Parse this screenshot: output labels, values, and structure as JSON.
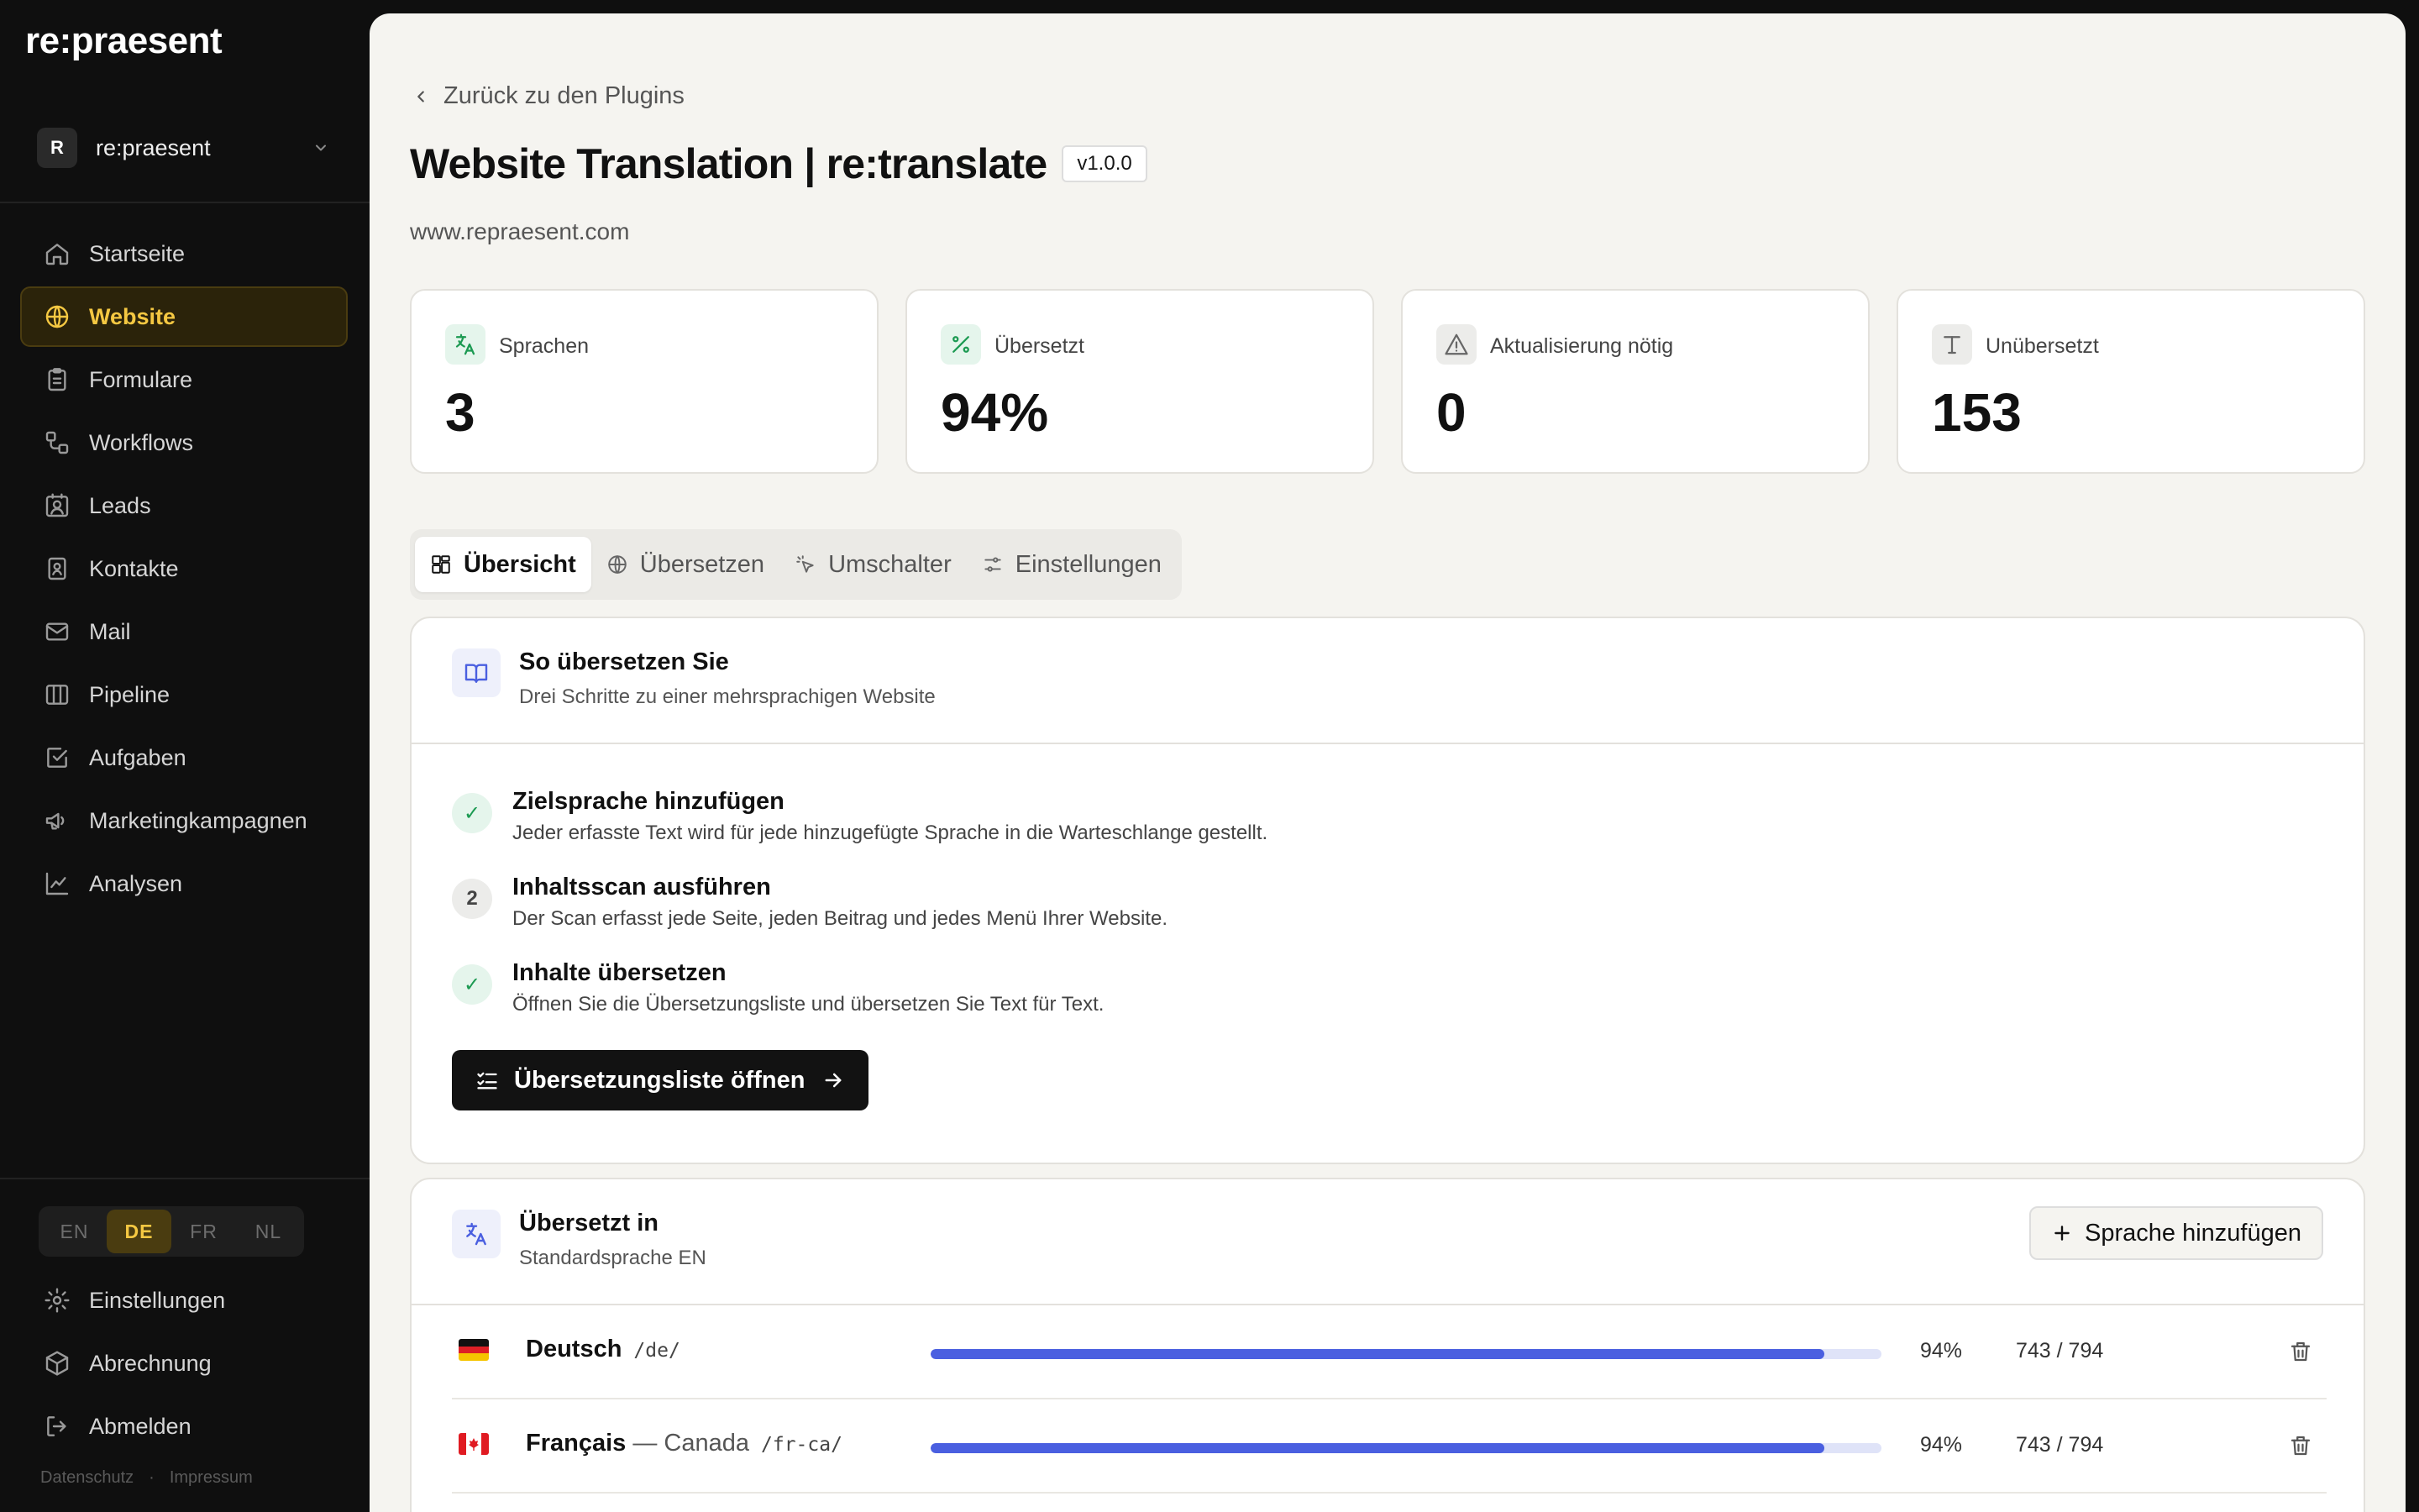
{
  "brand": "re:praesent",
  "workspace": {
    "initial": "R",
    "name": "re:praesent"
  },
  "nav": [
    {
      "label": "Startseite",
      "icon": "home-icon"
    },
    {
      "label": "Website",
      "icon": "globe-icon",
      "active": true
    },
    {
      "label": "Formulare",
      "icon": "clipboard-icon"
    },
    {
      "label": "Workflows",
      "icon": "workflow-icon"
    },
    {
      "label": "Leads",
      "icon": "contact-card-icon"
    },
    {
      "label": "Kontakte",
      "icon": "address-book-icon"
    },
    {
      "label": "Mail",
      "icon": "mail-icon"
    },
    {
      "label": "Pipeline",
      "icon": "columns-icon"
    },
    {
      "label": "Aufgaben",
      "icon": "check-square-icon"
    },
    {
      "label": "Marketingkampagnen",
      "icon": "megaphone-icon"
    },
    {
      "label": "Analysen",
      "icon": "line-chart-icon"
    }
  ],
  "languages": [
    "EN",
    "DE",
    "FR",
    "NL"
  ],
  "active_language": "DE",
  "bottom_nav": [
    {
      "label": "Einstellungen",
      "icon": "gear-icon"
    },
    {
      "label": "Abrechnung",
      "icon": "package-icon"
    },
    {
      "label": "Abmelden",
      "icon": "logout-icon"
    }
  ],
  "footer": {
    "privacy": "Datenschutz",
    "separator": "·",
    "imprint": "Impressum"
  },
  "back_label": "Zurück zu den Plugins",
  "page_title": "Website Translation | re:translate",
  "version": "v1.0.0",
  "site_url": "www.repraesent.com",
  "stats": [
    {
      "label": "Sprachen",
      "value": "3",
      "icon": "translate-icon",
      "color": "#1c9a52",
      "bg": "#e5f5ec"
    },
    {
      "label": "Übersetzt",
      "value": "94%",
      "icon": "percent-icon",
      "color": "#1c9a52",
      "bg": "#e5f5ec"
    },
    {
      "label": "Aktualisierung nötig",
      "value": "0",
      "icon": "warning-icon",
      "color": "#666666",
      "bg": "#ececea"
    },
    {
      "label": "Unübersetzt",
      "value": "153",
      "icon": "text-icon",
      "color": "#666666",
      "bg": "#ececea"
    }
  ],
  "tabs": [
    {
      "label": "Übersicht",
      "icon": "grid-icon",
      "active": true
    },
    {
      "label": "Übersetzen",
      "icon": "globe-icon"
    },
    {
      "label": "Umschalter",
      "icon": "pointer-icon"
    },
    {
      "label": "Einstellungen",
      "icon": "sliders-icon"
    }
  ],
  "howto": {
    "title": "So übersetzen Sie",
    "subtitle": "Drei Schritte zu einer mehrsprachigen Website",
    "steps": [
      {
        "badge": "✓",
        "state": "done",
        "title": "Zielsprache hinzufügen",
        "desc": "Jeder erfasste Text wird für jede hinzugefügte Sprache in die Warteschlange gestellt."
      },
      {
        "badge": "2",
        "state": "num",
        "title": "Inhaltsscan ausführen",
        "desc": "Der Scan erfasst jede Seite, jeden Beitrag und jedes Menü Ihrer Website."
      },
      {
        "badge": "✓",
        "state": "done",
        "title": "Inhalte übersetzen",
        "desc": "Öffnen Sie die Übersetzungsliste und übersetzen Sie Text für Text."
      }
    ],
    "cta": "Übersetzungsliste öffnen"
  },
  "translated": {
    "title": "Übersetzt in",
    "subtitle": "Standardsprache EN",
    "add_button": "Sprache hinzufügen",
    "rows": [
      {
        "name": "Deutsch",
        "region": "",
        "path": "/de/",
        "percent": "94%",
        "progress": 0.94,
        "count": "743 / 794",
        "flag": "de"
      },
      {
        "name": "Français",
        "region": " — Canada",
        "path": "/fr-ca/",
        "percent": "94%",
        "progress": 0.94,
        "count": "743 / 794",
        "flag": "ca"
      }
    ]
  }
}
